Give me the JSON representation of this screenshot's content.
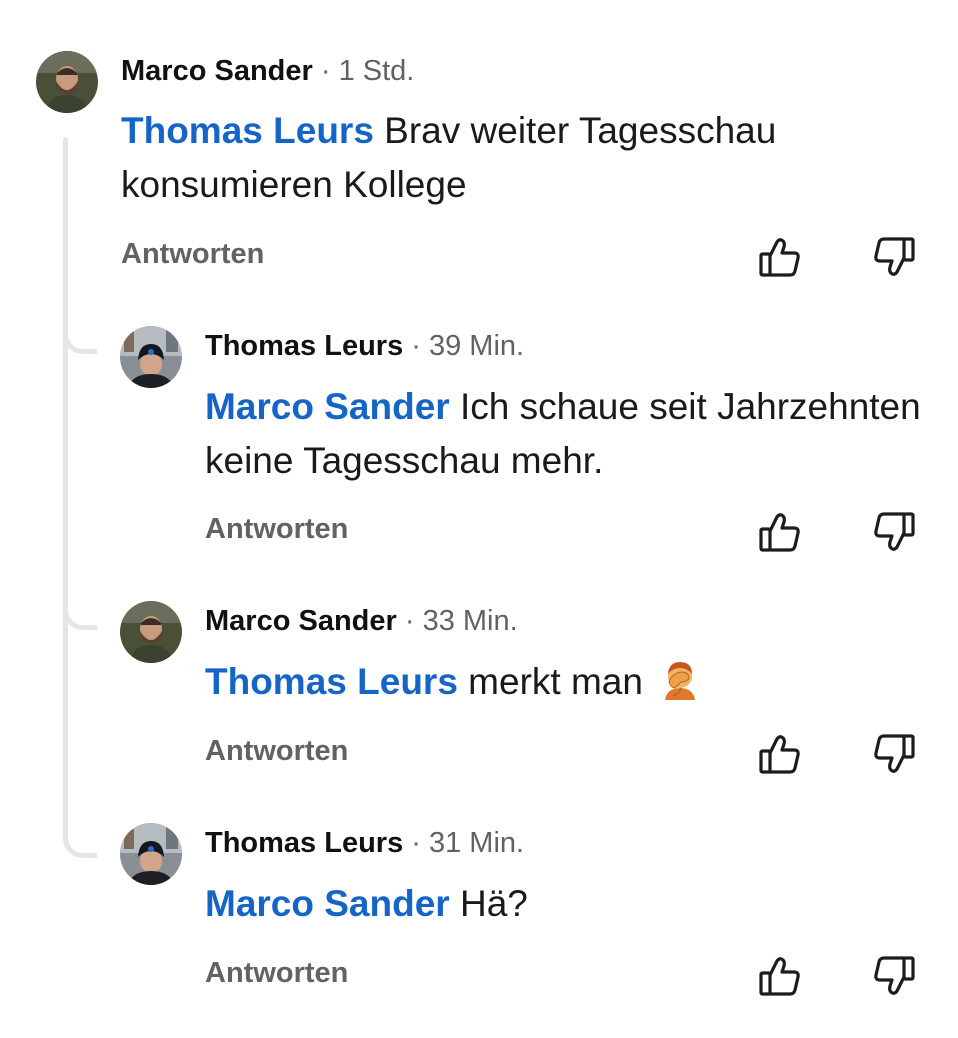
{
  "comments": [
    {
      "author": "Marco Sander",
      "time": "· 1 Std.",
      "mention": "Thomas Leurs",
      "text": " Brav weiter Tagesschau konsumieren Kollege",
      "reply_label": "Antworten",
      "avatar": "avatar-marco"
    },
    {
      "author": "Thomas Leurs",
      "time": "· 39 Min.",
      "mention": "Marco Sander",
      "text": " Ich schaue seit Jahrzehnten keine Tagesschau mehr.",
      "reply_label": "Antworten",
      "avatar": "avatar-thomas"
    },
    {
      "author": "Marco Sander",
      "time": "· 33 Min.",
      "mention": "Thomas Leurs",
      "text": " merkt man ",
      "emoji": "facepalm-emoji",
      "reply_label": "Antworten",
      "avatar": "avatar-marco"
    },
    {
      "author": "Thomas Leurs",
      "time": "· 31 Min.",
      "mention": "Marco Sander",
      "text": " Hä?",
      "reply_label": "Antworten",
      "avatar": "avatar-thomas"
    }
  ],
  "icons": {
    "upvote": "thumbs-up-icon",
    "downvote": "thumbs-down-icon"
  },
  "colors": {
    "mention": "#1565c8",
    "secondary_text": "#5f6368",
    "thread_line": "#e3e5e8"
  }
}
